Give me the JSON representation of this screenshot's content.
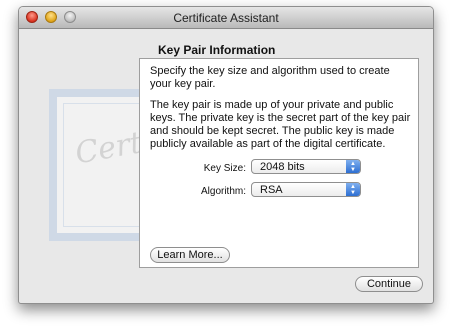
{
  "window": {
    "title": "Certificate Assistant"
  },
  "page": {
    "heading": "Key Pair Information",
    "paragraph1": "Specify the key size and algorithm used to create your key pair.",
    "paragraph2": "The key pair is made up of your private and public keys. The private key is the secret part of the key pair and should be kept secret. The public key is made publicly available as part of the digital certificate."
  },
  "form": {
    "key_size_label": "Key Size:",
    "key_size_value": "2048 bits",
    "algorithm_label": "Algorithm:",
    "algorithm_value": "RSA"
  },
  "buttons": {
    "learn_more": "Learn More...",
    "continue": "Continue"
  },
  "decoration": {
    "certificate_text": "Certif"
  }
}
